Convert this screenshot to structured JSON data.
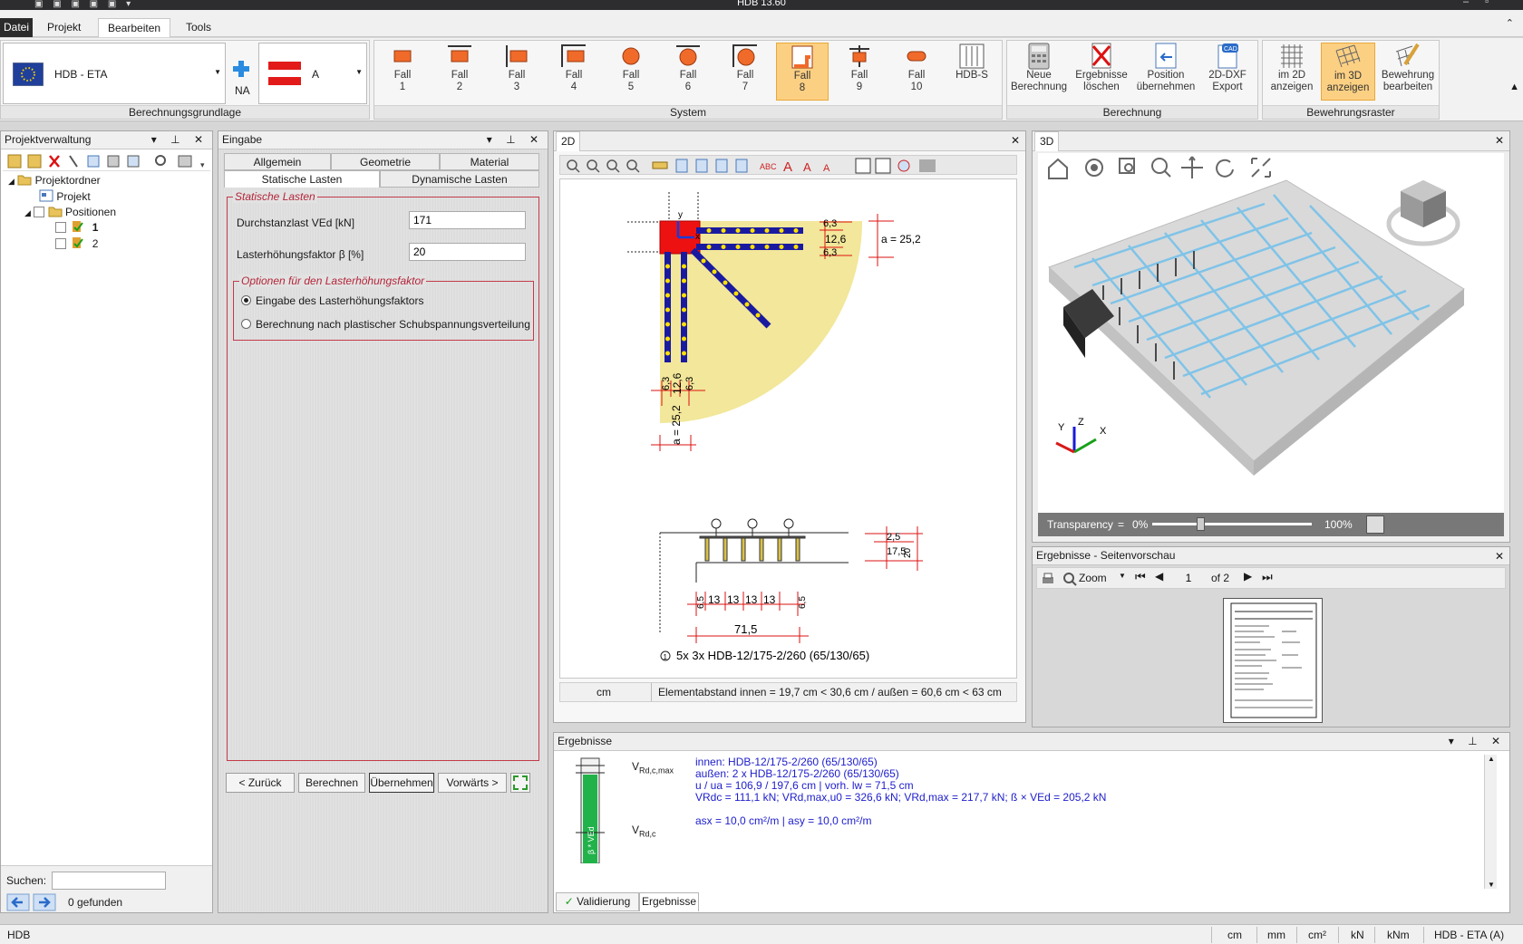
{
  "app": {
    "title": "HDB 13.60"
  },
  "menu": {
    "file": "Datei",
    "tabs": [
      "Projekt",
      "Bearbeiten",
      "Tools"
    ]
  },
  "ribbon": {
    "norm_combo": "HDB - ETA",
    "na_label": "NA",
    "country_combo": "A",
    "group_basis": "Berechnungsgrundlage",
    "group_system": "System",
    "group_calc": "Berechnung",
    "group_grid": "Bewehrungsraster",
    "fall": [
      {
        "l1": "Fall",
        "l2": "1"
      },
      {
        "l1": "Fall",
        "l2": "2"
      },
      {
        "l1": "Fall",
        "l2": "3"
      },
      {
        "l1": "Fall",
        "l2": "4"
      },
      {
        "l1": "Fall",
        "l2": "5"
      },
      {
        "l1": "Fall",
        "l2": "6"
      },
      {
        "l1": "Fall",
        "l2": "7"
      },
      {
        "l1": "Fall",
        "l2": "8"
      },
      {
        "l1": "Fall",
        "l2": "9"
      },
      {
        "l1": "Fall",
        "l2": "10"
      }
    ],
    "hdbs": "HDB-S",
    "calc_buttons": [
      {
        "l1": "Neue",
        "l2": "Berechnung"
      },
      {
        "l1": "Ergebnisse",
        "l2": "löschen"
      },
      {
        "l1": "Position",
        "l2": "übernehmen"
      },
      {
        "l1": "2D-DXF",
        "l2": "Export"
      }
    ],
    "grid_buttons": [
      {
        "l1": "im 2D",
        "l2": "anzeigen"
      },
      {
        "l1": "im 3D",
        "l2": "anzeigen"
      },
      {
        "l1": "Bewehrung",
        "l2": "bearbeiten"
      }
    ]
  },
  "project_panel": {
    "title": "Projektverwaltung",
    "tree": {
      "root": "Projektordner",
      "project": "Projekt",
      "positions": "Positionen",
      "items": [
        "1",
        "2"
      ]
    },
    "search_label": "Suchen:",
    "found": "0 gefunden"
  },
  "input_panel": {
    "title": "Eingabe",
    "tabs_row1": [
      "Allgemein",
      "Geometrie",
      "Material"
    ],
    "tabs_row2": [
      "Statische Lasten",
      "Dynamische Lasten"
    ],
    "group_title": "Statische Lasten",
    "load_label": "Durchstanzlast  VEd  [kN]",
    "load_value": "171",
    "factor_label": "Lasterhöhungsfaktor  β  [%]",
    "factor_value": "20",
    "options_title": "Optionen für den Lasterhöhungsfaktor",
    "option1": "Eingabe des Lasterhöhungsfaktors",
    "option2": "Berechnung nach plastischer Schubspannungsverteilung",
    "buttons": [
      "< Zurück",
      "Berechnen",
      "Übernehmen",
      "Vorwärts >"
    ]
  },
  "view2d": {
    "tab": "2D",
    "dims": {
      "d63a": "6,3",
      "d126a": "12,6",
      "d63b": "6,3",
      "a252a": "a = 25,2",
      "d63c": "6,3",
      "d126b": "12,6",
      "d63d": "6,3",
      "a252b": "a = 25,2",
      "axis_y": "y",
      "axis_x": "x",
      "s25": "2,5",
      "s175": "17,5",
      "s20": "20",
      "r65a": "6,5",
      "r13": [
        "13",
        "13",
        "13",
        "13"
      ],
      "r65b": "6,5",
      "total": "71,5",
      "caption": "5x 3x HDB-12/175-2/260  (65/130/65)",
      "marker": "1"
    },
    "status_unit": "cm",
    "status_text": "Elementabstand innen = 19,7 cm < 30,6 cm / außen = 60,6 cm < 63 cm"
  },
  "view3d": {
    "tab": "3D",
    "transparency_label": "Transparency",
    "transparency_eq": "=",
    "transparency_min": "0%",
    "transparency_max": "100%",
    "transparency_value": 0.3,
    "axes": {
      "x": "X",
      "y": "Y",
      "z": "Z"
    }
  },
  "preview": {
    "title": "Ergebnisse - Seitenvorschau",
    "zoom": "Zoom",
    "page": "1",
    "of": "of 2"
  },
  "results": {
    "title": "Ergebnisse",
    "vmax": "V",
    "vmax_sub": "Rd,c,max",
    "vrdc": "V",
    "vrdc_sub": "Rd,c",
    "bar_label": "β * VEd",
    "lines": [
      "innen: HDB-12/175-2/260 (65/130/65)",
      "außen: 2 x HDB-12/175-2/260 (65/130/65)",
      "u / ua = 106,9 / 197,6 cm | vorh. lw = 71,5 cm",
      "VRdc = 111,1 kN; VRd,max,u0 = 326,6 kN; VRd,max = 217,7 kN; ß × VEd = 205,2 kN",
      "asx = 10,0 cm²/m | asy = 10,0 cm²/m"
    ],
    "tabs": [
      "Validierung",
      "Ergebnisse"
    ]
  },
  "statusbar": {
    "left": "HDB",
    "units": [
      "cm",
      "mm",
      "cm²",
      "kN",
      "kNm"
    ],
    "norm": "HDB - ETA (A)"
  },
  "colors": {
    "accent": "#fcd083",
    "column": "#ee1111",
    "rail": "#1a1aa0",
    "stud": "#ffe000",
    "zone": "#f2e79a",
    "rebar": "#7fc3e8",
    "result_text": "#1d1dcc"
  }
}
